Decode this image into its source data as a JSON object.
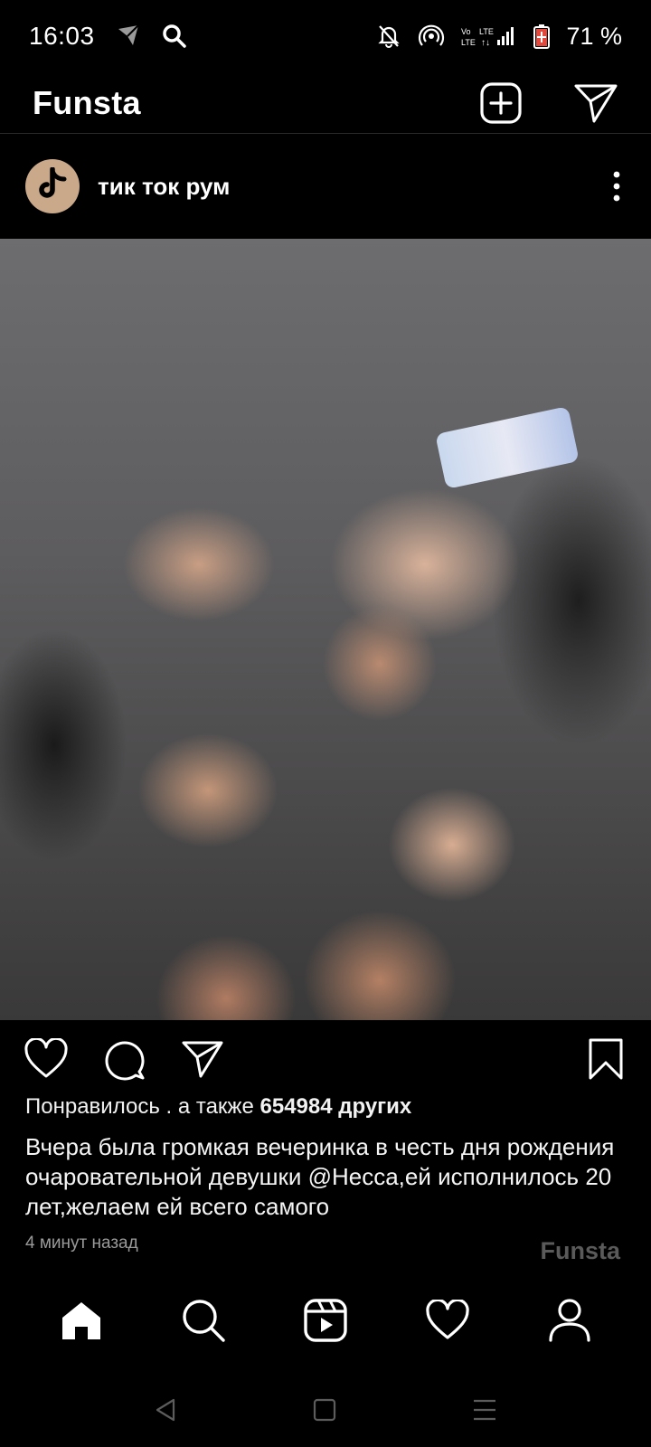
{
  "status_bar": {
    "time": "16:03",
    "battery": "71 %",
    "icons": [
      "location-shield-icon",
      "search-icon",
      "mute-bell-icon",
      "hotspot-icon",
      "volte-lte-signal-icon",
      "battery-icon"
    ]
  },
  "header": {
    "title": "Funsta",
    "icons": [
      "add-post-icon",
      "direct-send-icon"
    ]
  },
  "post": {
    "username": "тик ток рум",
    "avatar_icon": "tiktok-logo-icon",
    "more_icon": "more-vertical-icon",
    "likes_prefix": "Понравилось . а также ",
    "likes_count": "654984 других",
    "caption": "Вчера была громкая вечеринка в честь дня рождения очаровательной девушки @Несса,ей исполнилось 20 лет,желаем ей всего самого",
    "timestamp": "4 минут назад",
    "watermark": "Funsta",
    "action_icons": [
      "heart-icon",
      "comment-icon",
      "share-icon",
      "bookmark-icon"
    ]
  },
  "bottom_nav": {
    "items": [
      "home-icon",
      "search-icon",
      "reels-icon",
      "activity-heart-icon",
      "profile-icon"
    ]
  },
  "system_nav": {
    "items": [
      "back-icon",
      "home-square-icon",
      "recents-icon"
    ]
  },
  "colors": {
    "background": "#000000",
    "text": "#ffffff",
    "muted": "#9a9a9a",
    "watermark": "#5a5a5a",
    "avatar": "#c9a98a"
  }
}
